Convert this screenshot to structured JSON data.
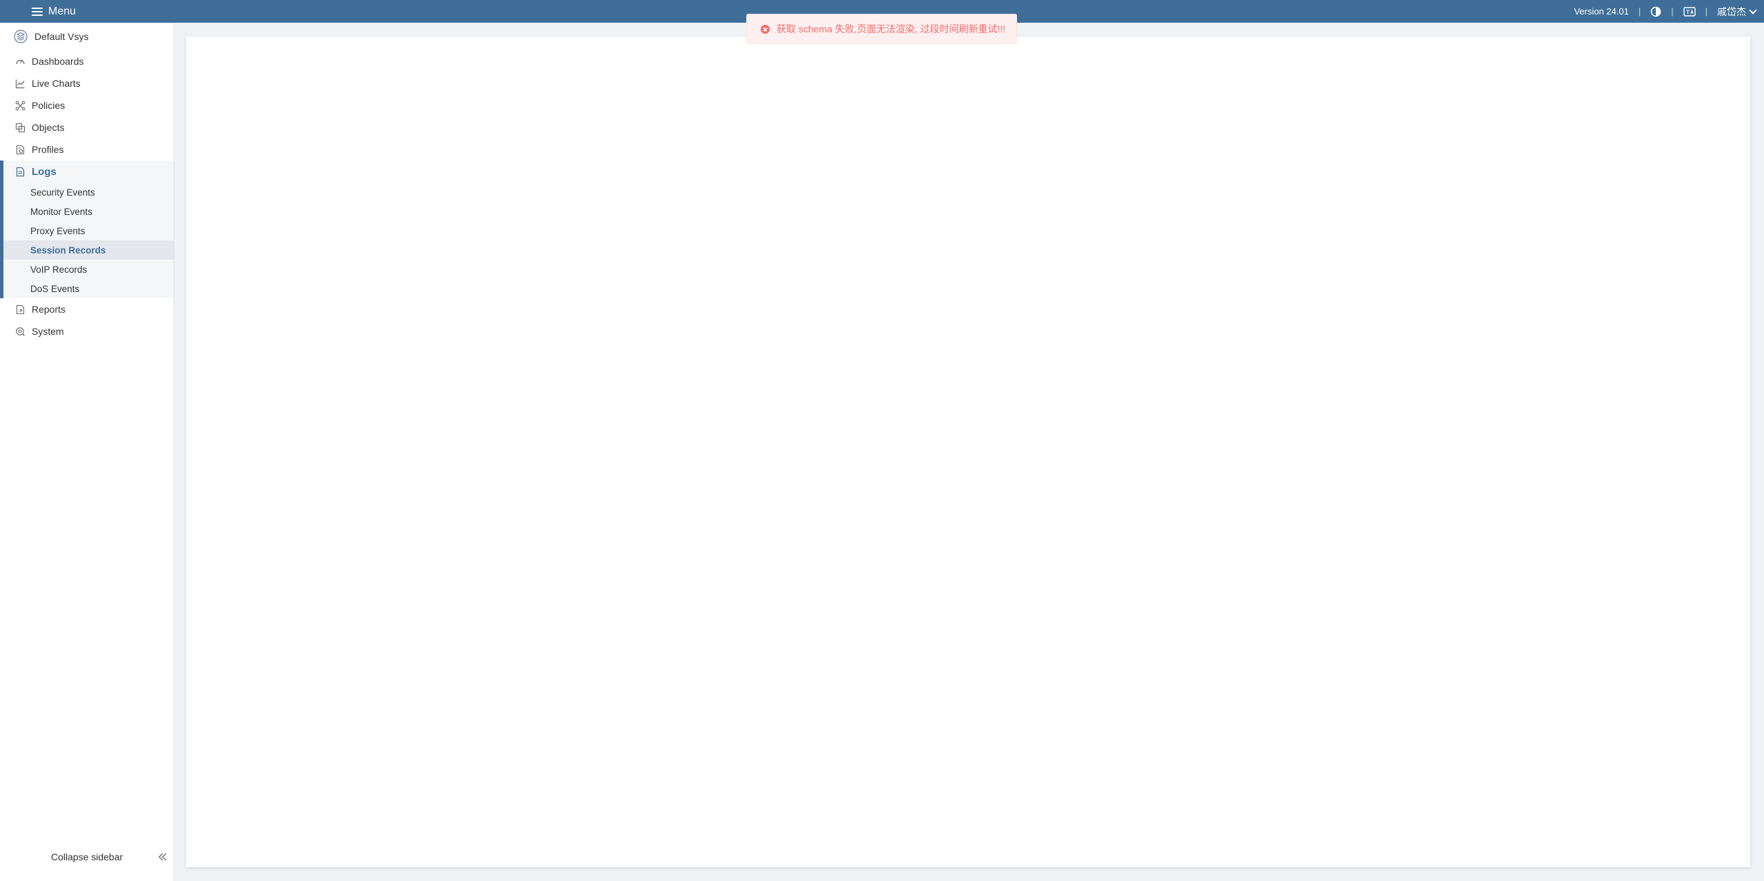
{
  "topbar": {
    "menu_label": "Menu",
    "version": "Version 24.01",
    "user_name": "戚岱杰",
    "icons": [
      "theme-toggle-icon",
      "language-icon",
      "chevron-down-icon"
    ]
  },
  "sidebar": {
    "vsys_label": "Default Vsys",
    "items": [
      {
        "label": "Dashboards",
        "icon": "dashboard-icon"
      },
      {
        "label": "Live Charts",
        "icon": "chart-icon"
      },
      {
        "label": "Policies",
        "icon": "policy-icon"
      },
      {
        "label": "Objects",
        "icon": "objects-icon"
      },
      {
        "label": "Profiles",
        "icon": "profiles-icon"
      }
    ],
    "logs": {
      "label": "Logs",
      "icon": "logs-icon",
      "children": [
        "Security Events",
        "Monitor Events",
        "Proxy Events",
        "Session Records",
        "VoIP Records",
        "DoS Events"
      ],
      "active_child": "Session Records"
    },
    "items_after": [
      {
        "label": "Reports",
        "icon": "reports-icon"
      },
      {
        "label": "System",
        "icon": "system-icon"
      }
    ],
    "collapse_label": "Collapse sidebar"
  },
  "toast": {
    "type": "error",
    "message": "获取 schema 失败,页面无法渲染, 过段时间刷新重试!!!"
  },
  "colors": {
    "topbar": "#3f6f99",
    "accent": "#3f6f99",
    "error": "#f56c6c"
  }
}
